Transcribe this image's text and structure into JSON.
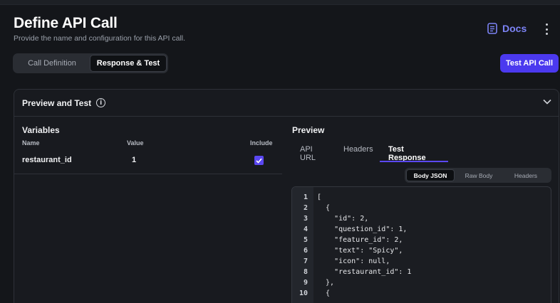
{
  "header": {
    "title": "Define API Call",
    "subtitle": "Provide the name and configuration for this API call.",
    "docs_label": "Docs",
    "docs_icon": "document-icon",
    "more_icon": "kebab-menu-icon"
  },
  "mode_tabs": {
    "definition": "Call Definition",
    "response": "Response & Test",
    "active": "Response & Test"
  },
  "actions": {
    "test_label": "Test API Call"
  },
  "panel": {
    "title": "Preview and Test",
    "info_glyph": "i",
    "collapse_icon": "chevron-down-icon"
  },
  "variables": {
    "title": "Variables",
    "columns": {
      "name": "Name",
      "value": "Value",
      "include": "Include"
    },
    "rows": [
      {
        "name": "restaurant_id",
        "value": "1",
        "include": true
      }
    ]
  },
  "preview": {
    "title": "Preview",
    "tabs": [
      "API URL",
      "Headers",
      "Test Response"
    ],
    "active_tab": "Test Response",
    "body_tabs": [
      "Body JSON",
      "Raw Body",
      "Headers"
    ],
    "active_body_tab": "Body JSON",
    "code_lines": [
      {
        "n": "1",
        "text": "["
      },
      {
        "n": "2",
        "text": "  {"
      },
      {
        "n": "3",
        "text": "    \"id\": 2,"
      },
      {
        "n": "4",
        "text": "    \"question_id\": 1,"
      },
      {
        "n": "5",
        "text": "    \"feature_id\": 2,"
      },
      {
        "n": "6",
        "text": "    \"text\": \"Spicy\","
      },
      {
        "n": "7",
        "text": "    \"icon\": null,"
      },
      {
        "n": "8",
        "text": "    \"restaurant_id\": 1"
      },
      {
        "n": "9",
        "text": "  },"
      },
      {
        "n": "10",
        "text": "  {"
      }
    ]
  },
  "colors": {
    "accent": "#4b39ef",
    "docs": "#7c83f5",
    "background": "#14161a"
  }
}
